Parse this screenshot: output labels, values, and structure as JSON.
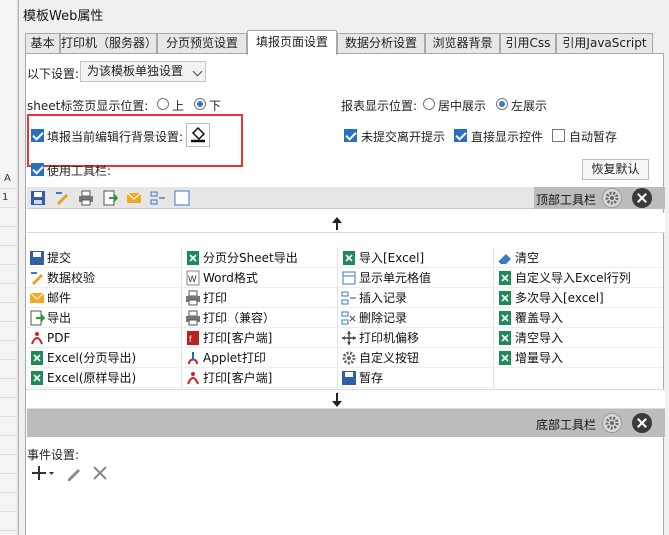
{
  "window": {
    "title": "模板Web属性"
  },
  "background": {
    "column_label": "A",
    "row_label": "1"
  },
  "tabs": [
    {
      "label": "基本"
    },
    {
      "label": "打印机（服务器）"
    },
    {
      "label": "分页预览设置"
    },
    {
      "label": "填报页面设置",
      "active": true
    },
    {
      "label": "数据分析设置"
    },
    {
      "label": "浏览器背景"
    },
    {
      "label": "引用Css"
    },
    {
      "label": "引用JavaScript"
    }
  ],
  "settings": {
    "scope_label": "以下设置:",
    "scope_value": "为该模板单独设置",
    "sheet_tab_label": "sheet标签页显示位置:",
    "sheet_tab_options": [
      "上",
      "下"
    ],
    "sheet_tab_selected": "下",
    "report_pos_label": "报表显示位置:",
    "report_pos_options": [
      "居中展示",
      "左展示"
    ],
    "report_pos_selected": "左展示",
    "fill_bg_label": "填报当前编辑行背景设置:",
    "fill_bg_checked": true,
    "unsubmitted_leave_label": "未提交离开提示",
    "unsubmitted_leave_checked": true,
    "direct_show_controls_label": "直接显示控件",
    "direct_show_controls_checked": true,
    "auto_save_label": "自动暂存",
    "auto_save_checked": false,
    "use_toolbar_label": "使用工具栏:",
    "use_toolbar_checked": true,
    "restore_default_label": "恢复默认"
  },
  "toolbar": {
    "top_label": "顶部工具栏",
    "bottom_label": "底部工具栏",
    "strip_icons": [
      "save-icon",
      "edit-icon",
      "print-icon",
      "export-icon",
      "mail-icon",
      "insert-row-icon",
      "blank-icon"
    ]
  },
  "buttons_grid": {
    "columns": [
      [
        {
          "label": "提交",
          "icon": "save-icon"
        },
        {
          "label": "数据校验",
          "icon": "edit-icon"
        },
        {
          "label": "邮件",
          "icon": "mail-icon"
        },
        {
          "label": "导出",
          "icon": "export-icon"
        },
        {
          "label": "PDF",
          "icon": "pdf-icon"
        },
        {
          "label": "Excel(分页导出)",
          "icon": "excel-icon"
        },
        {
          "label": "Excel(原样导出)",
          "icon": "excel-icon"
        }
      ],
      [
        {
          "label": "分页分Sheet导出",
          "icon": "excel-icon"
        },
        {
          "label": "Word格式",
          "icon": "word-icon"
        },
        {
          "label": "打印",
          "icon": "print-icon"
        },
        {
          "label": "打印（兼容）",
          "icon": "print-icon"
        },
        {
          "label": "打印[客户端]",
          "icon": "flash-print-icon"
        },
        {
          "label": "Applet打印",
          "icon": "applet-icon"
        },
        {
          "label": "打印[客户端]",
          "icon": "pdf-print-icon"
        }
      ],
      [
        {
          "label": "导入[Excel]",
          "icon": "excel-icon"
        },
        {
          "label": "显示单元格值",
          "icon": "cell-icon"
        },
        {
          "label": "插入记录",
          "icon": "insert-row-icon"
        },
        {
          "label": "删除记录",
          "icon": "delete-row-icon"
        },
        {
          "label": "打印机偏移",
          "icon": "move-icon"
        },
        {
          "label": "自定义按钮",
          "icon": "gear-icon"
        },
        {
          "label": "暂存",
          "icon": "save-icon"
        }
      ],
      [
        {
          "label": "清空",
          "icon": "eraser-icon"
        },
        {
          "label": "自定义导入Excel行列",
          "icon": "excel-icon"
        },
        {
          "label": "多次导入[excel]",
          "icon": "excel-icon"
        },
        {
          "label": "覆盖导入",
          "icon": "excel-icon"
        },
        {
          "label": "清空导入",
          "icon": "excel-icon"
        },
        {
          "label": "增量导入",
          "icon": "excel-icon"
        }
      ]
    ]
  },
  "events": {
    "label": "事件设置:"
  }
}
